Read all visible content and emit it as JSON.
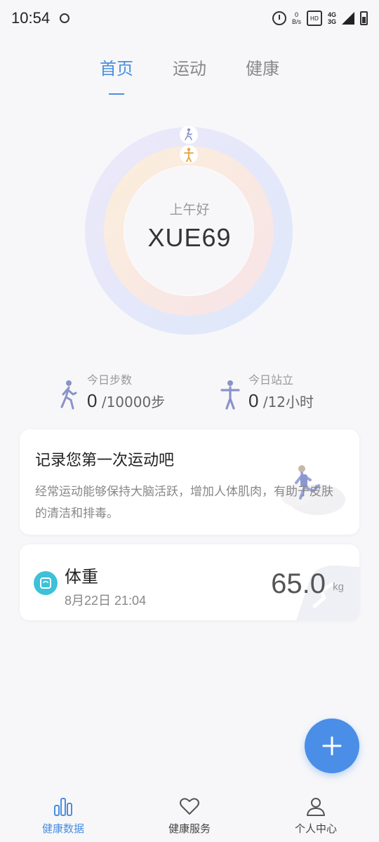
{
  "status_bar": {
    "time": "10:54",
    "speed_value": "0",
    "speed_unit": "B/s",
    "sim_label": "HD",
    "net_top": "4G",
    "net_bottom": "3G"
  },
  "top_tabs": [
    {
      "label": "首页",
      "active": true
    },
    {
      "label": "运动",
      "active": false
    },
    {
      "label": "健康",
      "active": false
    }
  ],
  "ring": {
    "greeting": "上午好",
    "username": "XUE69",
    "outer_color": "#e3e6f9",
    "inner_color": "#f9e8df",
    "outer_icon": "walking-icon",
    "inner_icon": "standing-icon"
  },
  "stats": {
    "steps": {
      "label": "今日步数",
      "value": "0",
      "goal": "/10000步",
      "icon": "walking-icon"
    },
    "stand": {
      "label": "今日站立",
      "value": "0",
      "goal": "/12小时",
      "icon": "standing-icon"
    }
  },
  "exercise_card": {
    "title": "记录您第一次运动吧",
    "description": "经常运动能够保持大脑活跃，增加人体肌肉，有助于皮肤的清洁和排毒。"
  },
  "weight_card": {
    "title": "体重",
    "date": "8月22日  21:04",
    "value": "65.0",
    "unit": "kg",
    "icon": "scale-icon"
  },
  "bottom_nav": [
    {
      "label": "健康数据",
      "icon": "bar-chart-icon",
      "active": true
    },
    {
      "label": "健康服务",
      "icon": "heart-icon",
      "active": false
    },
    {
      "label": "个人中心",
      "icon": "person-icon",
      "active": false
    }
  ],
  "colors": {
    "accent": "#4a8ee0",
    "fab": "#4a8ee8",
    "scale_icon_bg": "#3ec1d8",
    "step_icon": "#8a93c8",
    "stand_icon": "#8a93c8"
  }
}
